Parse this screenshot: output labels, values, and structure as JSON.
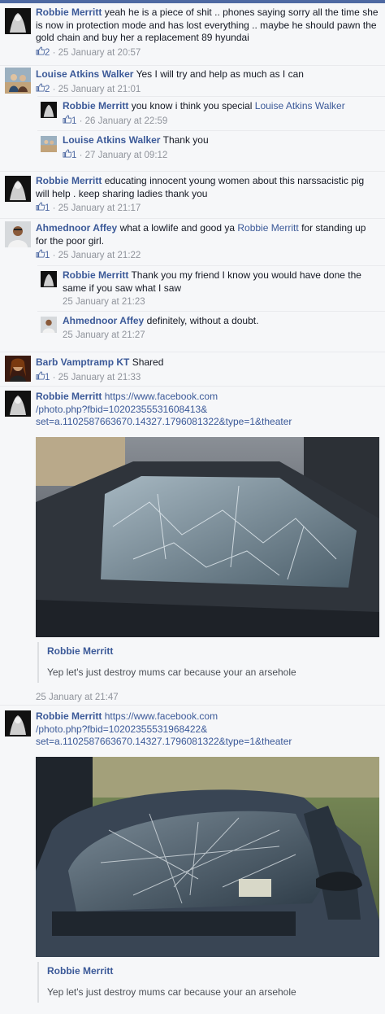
{
  "comments": [
    {
      "name": "Robbie Merritt",
      "text": "yeah he is a piece of shit .. phones saying sorry all the time she is now in protection mode and has lost everything .. maybe he should pawn the gold chain and buy her a replacement 89 hyundai",
      "likes": "2",
      "time": "25 January at 20:57"
    },
    {
      "name": "Louise Atkins Walker",
      "text": "Yes I will try and help as much as I can",
      "likes": "2",
      "time": "25 January at 21:01"
    },
    {
      "name": "Robbie Merritt",
      "text": "you know i think you special",
      "tag": "Louise Atkins Walker",
      "likes": "1",
      "time": "26 January at 22:59"
    },
    {
      "name": "Louise Atkins Walker",
      "text": "Thank you",
      "likes": "1",
      "time": "27 January at 09:12"
    },
    {
      "name": "Robbie Merritt",
      "text": "educating innocent young women about this narssacistic pig will help . keep sharing ladies thank you",
      "likes": "1",
      "time": "25 January at 21:17"
    },
    {
      "name": "Ahmednoor Affey",
      "text_before": "what a lowlife and good ya",
      "tag": "Robbie Merritt",
      "text_after": "for standing up for the poor girl.",
      "likes": "1",
      "time": "25 January at 21:22"
    },
    {
      "name": "Robbie Merritt",
      "text": "Thank you my friend I know you would have done the same if you saw what I saw",
      "time": "25 January at 21:23"
    },
    {
      "name": "Ahmednoor Affey",
      "text": "definitely, without a doubt.",
      "time": "25 January at 21:27"
    },
    {
      "name": "Barb Vamptramp KT",
      "text": "Shared",
      "likes": "1",
      "time": "25 January at 21:33"
    },
    {
      "name": "Robbie Merritt",
      "url_line1": "https://www.facebook.com",
      "url_line2": "/photo.php?fbid=10202355531608413&",
      "url_line3": "set=a.1102587663670.14327.1796081322&type=1&theater",
      "share_name": "Robbie Merritt",
      "share_text": "Yep let's just destroy mums car because your an arsehole",
      "time": "25 January at 21:47"
    },
    {
      "name": "Robbie Merritt",
      "url_line1": "https://www.facebook.com",
      "url_line2": "/photo.php?fbid=10202355531968422&",
      "url_line3": "set=a.1102587663670.14327.1796081322&type=1&theater",
      "share_name": "Robbie Merritt",
      "share_text": "Yep let's just destroy mums car because your an arsehole"
    }
  ],
  "separator": "·",
  "icons": {
    "like": "thumbs-up-icon"
  },
  "colors": {
    "link": "#3b5998",
    "meta": "#90949c",
    "background": "#f6f7f9"
  }
}
